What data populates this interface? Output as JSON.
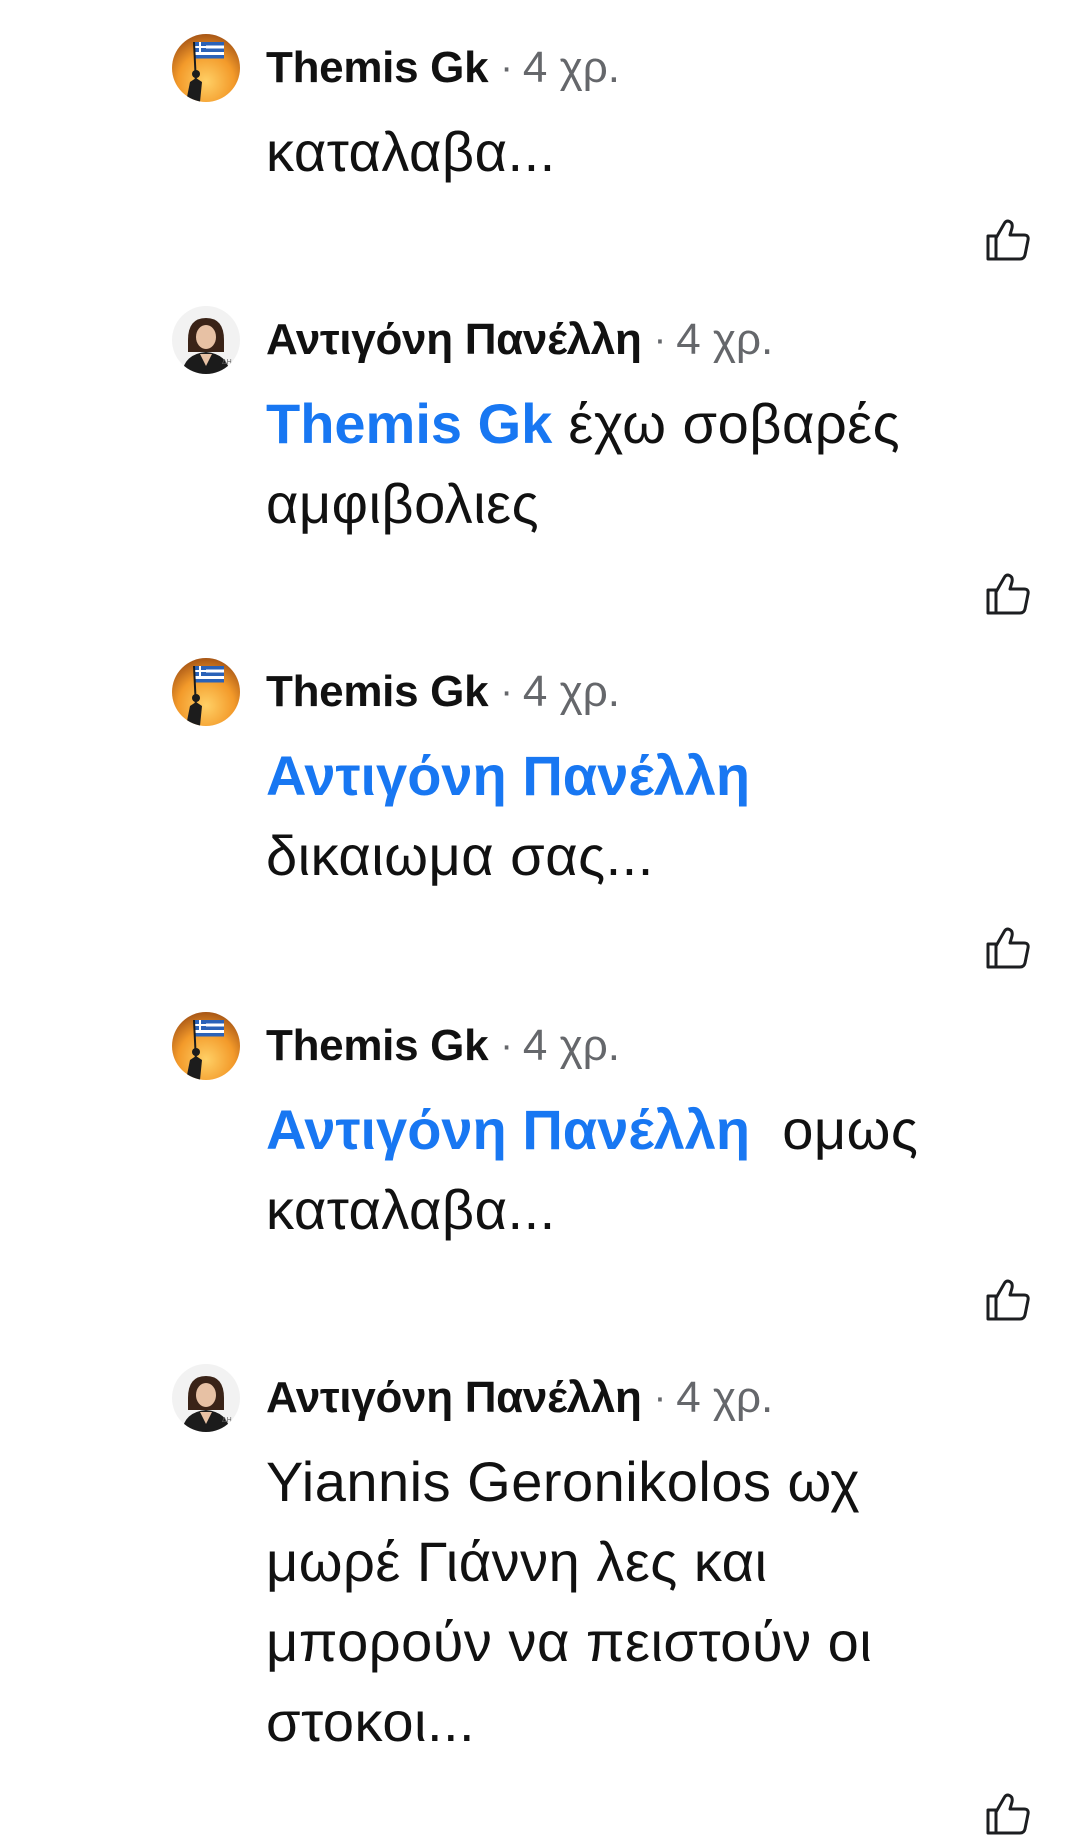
{
  "comments": [
    {
      "author": "Themis Gk",
      "separator": "·",
      "time": "4 χρ.",
      "avatar_icon": "flag-silhouette-avatar",
      "mention": "",
      "lines": [
        "καταλαβα..."
      ]
    },
    {
      "author": "Αντιγόνη Πανέλλη",
      "separator": "·",
      "time": "4 χρ.",
      "avatar_icon": "portrait-avatar",
      "mention": "Themis Gk",
      "lines": [
        " έχω σοβαρές",
        "αμφιβολιες"
      ]
    },
    {
      "author": "Themis Gk",
      "separator": "·",
      "time": "4 χρ.",
      "avatar_icon": "flag-silhouette-avatar",
      "mention": "Αντιγόνη Πανέλλη",
      "lines": [
        "",
        "δικαιωμα σας..."
      ]
    },
    {
      "author": "Themis Gk",
      "separator": "·",
      "time": "4 χρ.",
      "avatar_icon": "flag-silhouette-avatar",
      "mention": "Αντιγόνη Πανέλλη",
      "lines": [
        "  ομως",
        "καταλαβα..."
      ]
    },
    {
      "author": "Αντιγόνη Πανέλλη",
      "separator": "·",
      "time": "4 χρ.",
      "avatar_icon": "portrait-avatar",
      "mention": "",
      "lines": [
        "Yiannis Geronikolos ωχ",
        "μωρέ Γιάννη λες και",
        "μπορούν να πειστούν οι",
        "στοκοι..."
      ]
    }
  ],
  "colors": {
    "mention": "#1877f2",
    "text": "#111111",
    "meta": "#65676b",
    "background": "#ffffff"
  },
  "icons": {
    "like": "thumbs-up-icon"
  }
}
